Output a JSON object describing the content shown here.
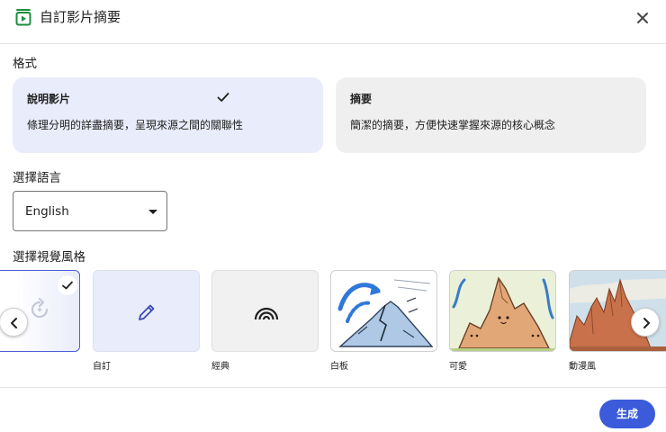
{
  "dialog": {
    "title": "自訂影片摘要",
    "close_icon": "close-icon",
    "app_icon": "video-summary-icon"
  },
  "format": {
    "label": "格式",
    "options": [
      {
        "title": "說明影片",
        "description": "條理分明的詳盡摘要，呈現來源之間的關聯性",
        "selected": true
      },
      {
        "title": "摘要",
        "description": "簡潔的摘要，方便快速掌握來源的核心概念",
        "selected": false
      }
    ]
  },
  "language": {
    "label": "選擇語言",
    "value": "English"
  },
  "visual_style": {
    "label": "選擇視覺風格",
    "options": [
      {
        "label": "",
        "icon": "refresh-sparkle-icon",
        "selected": true
      },
      {
        "label": "自訂",
        "icon": "pencil-icon",
        "selected": false
      },
      {
        "label": "經典",
        "icon": "rainbow-icon",
        "selected": false
      },
      {
        "label": "白板",
        "icon": "whiteboard-volcano-illustration",
        "selected": false
      },
      {
        "label": "可愛",
        "icon": "cute-rock-illustration",
        "selected": false
      },
      {
        "label": "動漫風",
        "icon": "anime-mountain-illustration",
        "selected": false
      }
    ],
    "prev_icon": "chevron-left-icon",
    "next_icon": "chevron-right-icon"
  },
  "actions": {
    "generate_label": "生成"
  },
  "colors": {
    "accent": "#3b5bdb",
    "selected_bg": "#e9ecfa",
    "unselected_bg": "#efefef"
  }
}
